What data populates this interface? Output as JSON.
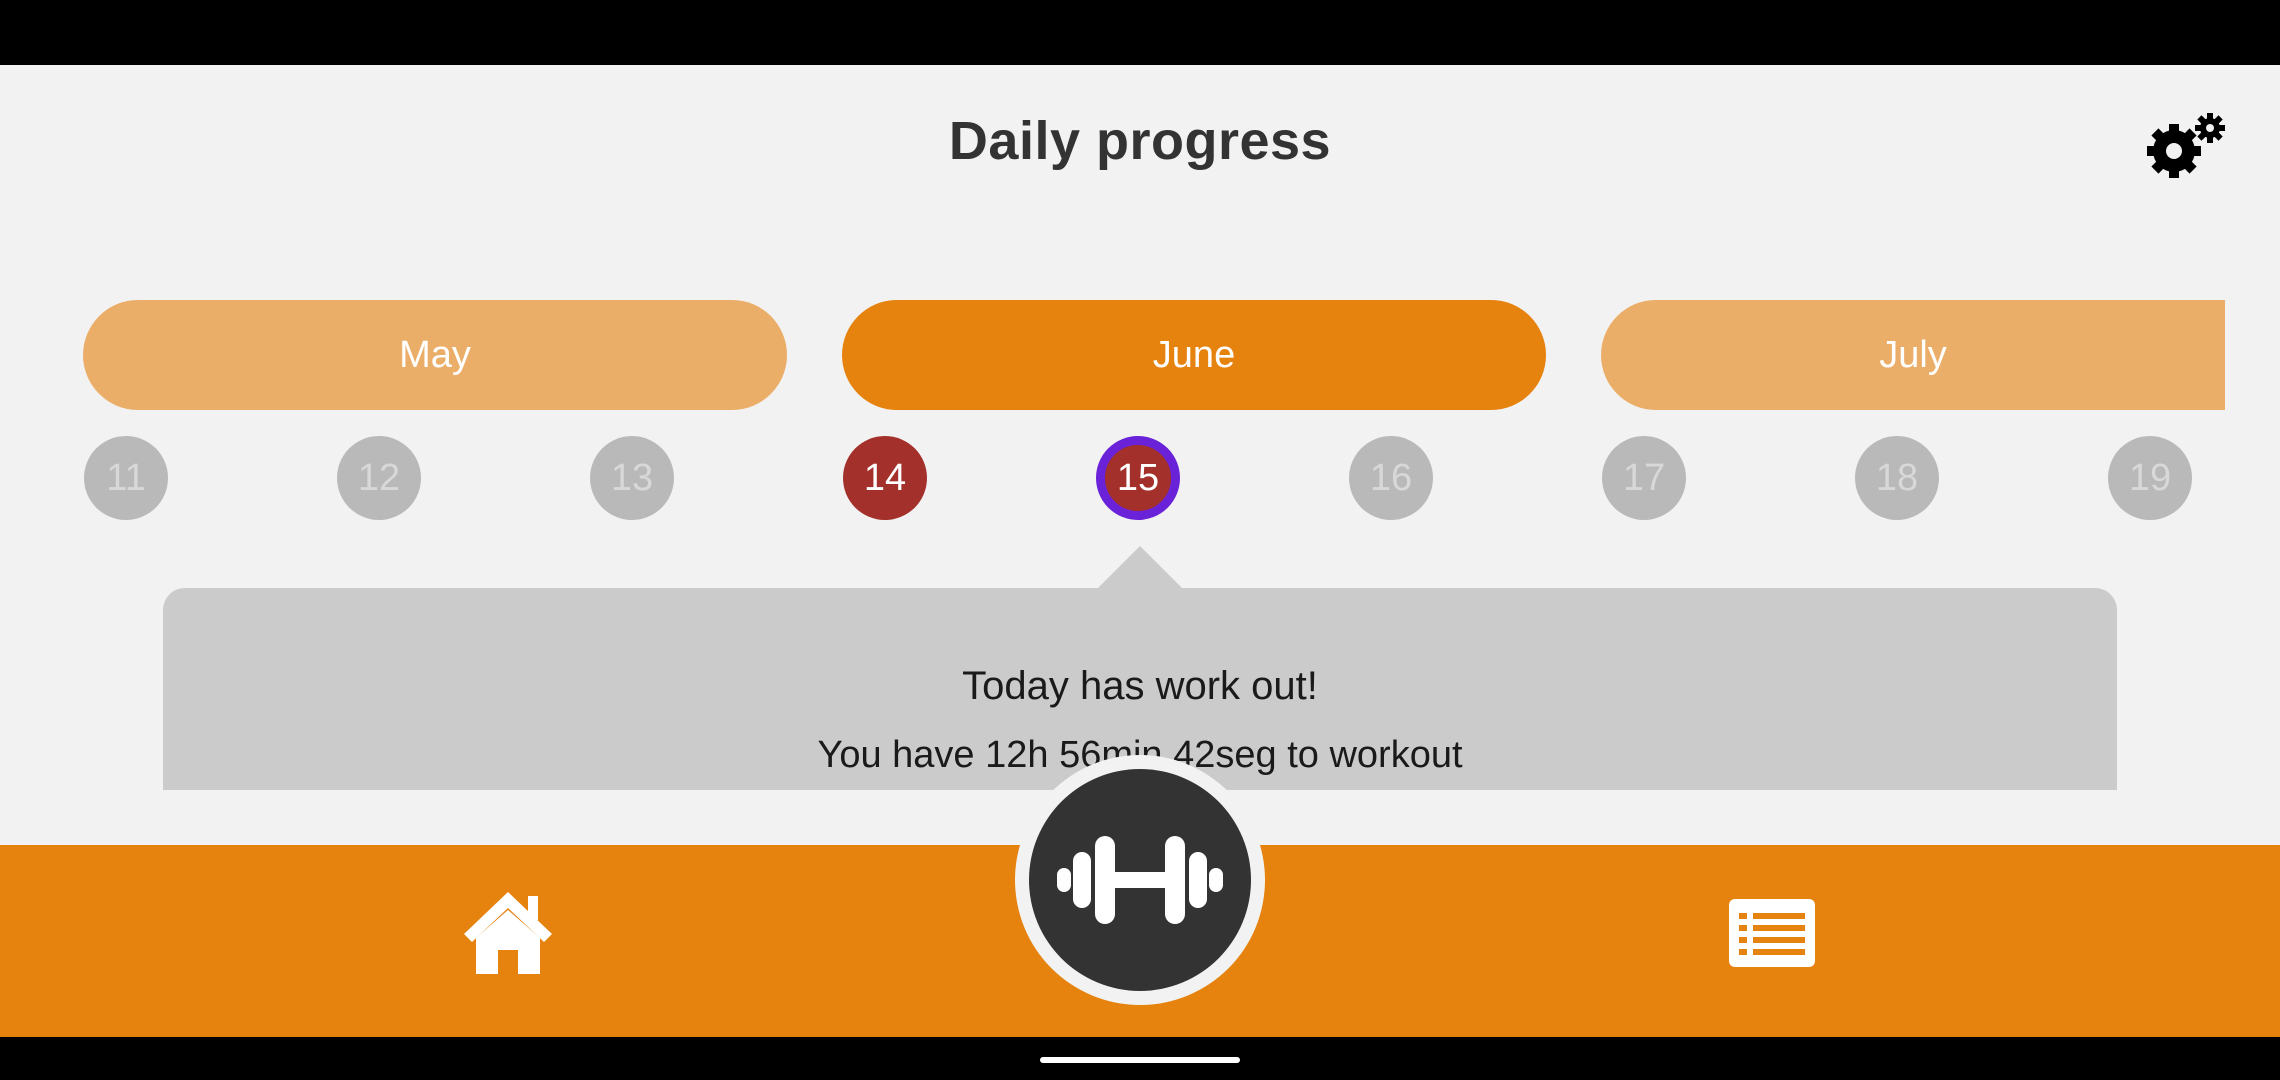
{
  "header": {
    "title": "Daily progress",
    "settings_icon": "gears-icon"
  },
  "months": [
    {
      "label": "May",
      "state": "inactive"
    },
    {
      "label": "June",
      "state": "selected"
    },
    {
      "label": "July",
      "state": "inactive"
    }
  ],
  "days": [
    {
      "label": "11",
      "status": "none"
    },
    {
      "label": "12",
      "status": "none"
    },
    {
      "label": "13",
      "status": "none"
    },
    {
      "label": "14",
      "status": "worked-out"
    },
    {
      "label": "15",
      "status": "today"
    },
    {
      "label": "16",
      "status": "none"
    },
    {
      "label": "17",
      "status": "none"
    },
    {
      "label": "18",
      "status": "none"
    },
    {
      "label": "19",
      "status": "none"
    }
  ],
  "info": {
    "title": "Today has work out!",
    "subtitle": "You have 12h 56min 42seg to workout"
  },
  "bottom_nav": {
    "home_icon": "home-icon",
    "workout_icon": "dumbbell-icon",
    "list_icon": "list-icon"
  },
  "colors": {
    "accent": "#e6820e",
    "accent_light": "#ebae69",
    "done_day": "#a3302a",
    "today_ring": "#6a22d9",
    "inactive_day": "#b9b9b9",
    "panel": "#cbcbcb",
    "dark": "#333333"
  }
}
